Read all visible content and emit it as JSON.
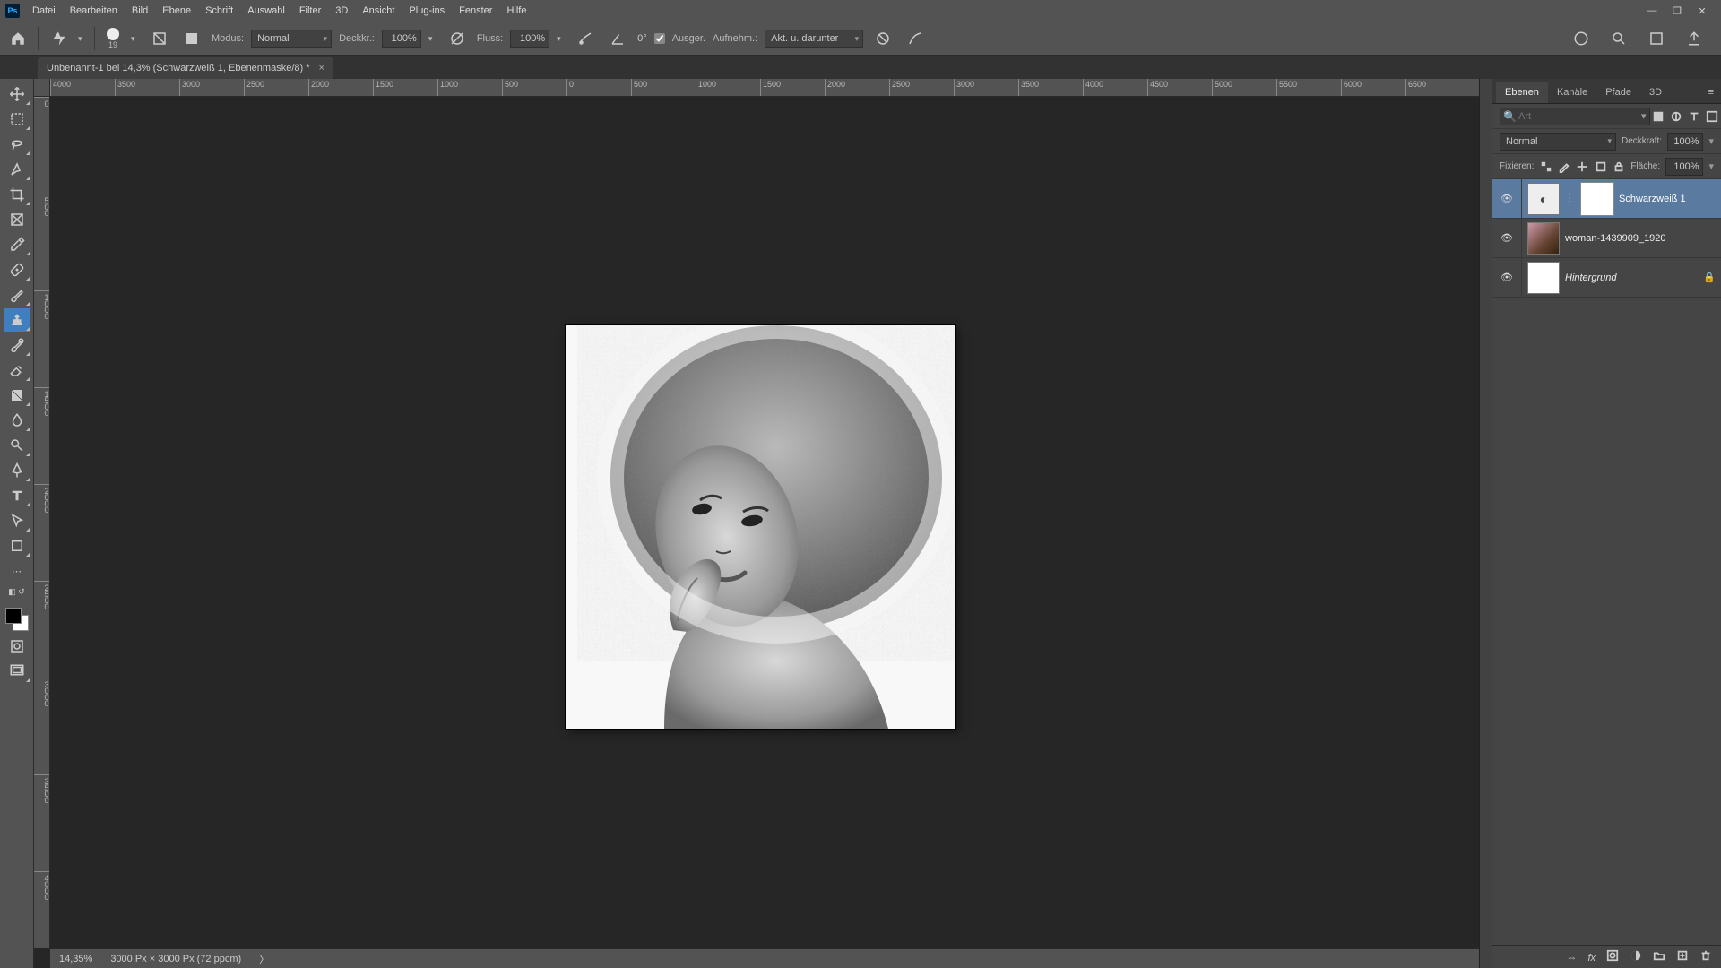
{
  "app": {
    "logo": "Ps"
  },
  "menu": [
    "Datei",
    "Bearbeiten",
    "Bild",
    "Ebene",
    "Schrift",
    "Auswahl",
    "Filter",
    "3D",
    "Ansicht",
    "Plug-ins",
    "Fenster",
    "Hilfe"
  ],
  "options": {
    "brush_size": "19",
    "mode_label": "Modus:",
    "mode_value": "Normal",
    "opacity_label": "Deckkr.:",
    "opacity_value": "100%",
    "flow_label": "Fluss:",
    "flow_value": "100%",
    "angle_label": "0°",
    "smooth_ck_label": "Ausger.",
    "sample_label": "Aufnehm.:",
    "sample_value": "Akt. u. darunter"
  },
  "doc_tab": {
    "title": "Unbenannt-1 bei 14,3% (Schwarzweiß 1, Ebenenmaske/8) *"
  },
  "ruler_h": [
    "4000",
    "3500",
    "3000",
    "2500",
    "2000",
    "1500",
    "1000",
    "500",
    "0",
    "500",
    "1000",
    "1500",
    "2000",
    "2500",
    "3000",
    "3500",
    "4000",
    "4500",
    "5000",
    "5500",
    "6000",
    "6500"
  ],
  "ruler_v": [
    "0",
    "500",
    "1000",
    "1500",
    "2000",
    "2500",
    "3000",
    "3500",
    "4000"
  ],
  "status": {
    "zoom": "14,35%",
    "info": "3000 Px × 3000 Px (72 ppcm)",
    "more": "〉"
  },
  "panels": {
    "tabs": [
      "Ebenen",
      "Kanäle",
      "Pfade",
      "3D"
    ],
    "search_ph": "Art",
    "blend_mode": "Normal",
    "opacity_label": "Deckkraft:",
    "opacity_value": "100%",
    "lock_label": "Fixieren:",
    "fill_label": "Fläche:",
    "fill_value": "100%"
  },
  "layers": [
    {
      "name": "Schwarzweiß 1",
      "kind": "adj",
      "selected": true,
      "locked": false,
      "italic": false
    },
    {
      "name": "woman-1439909_1920",
      "kind": "img",
      "selected": false,
      "locked": false,
      "italic": false
    },
    {
      "name": "Hintergrund",
      "kind": "bg",
      "selected": false,
      "locked": true,
      "italic": true
    }
  ]
}
